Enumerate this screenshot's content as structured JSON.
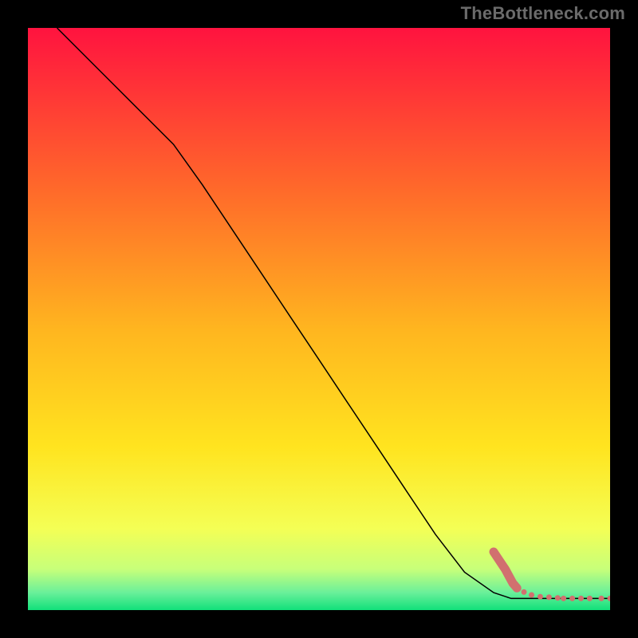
{
  "watermark": "TheBottleneck.com",
  "chart_data": {
    "type": "line",
    "title": "",
    "xlabel": "",
    "ylabel": "",
    "xlim": [
      0,
      100
    ],
    "ylim": [
      0,
      100
    ],
    "grid": false,
    "legend": false,
    "background_gradient": {
      "top_color": "#ff133f",
      "mid_upper_color": "#ff9a1f",
      "mid_color": "#ffe41f",
      "mid_lower_color": "#e8ff6c",
      "bottom_color": "#11e07a"
    },
    "series": [
      {
        "name": "black-curve",
        "type": "line",
        "color": "#000000",
        "width": 1.5,
        "x": [
          5,
          10,
          15,
          20,
          25,
          30,
          35,
          40,
          45,
          50,
          55,
          60,
          65,
          70,
          75,
          80,
          83,
          90,
          100
        ],
        "y": [
          100,
          95,
          90,
          85,
          80,
          73,
          65.5,
          58,
          50.5,
          43,
          35.5,
          28,
          20.5,
          13,
          6.5,
          3,
          2,
          2,
          2
        ]
      },
      {
        "name": "dotted-marker-trail",
        "type": "scatter",
        "color": "#d1706f",
        "marker_radius_main": 5,
        "marker_radius_small": 3.5,
        "x": [
          80,
          81,
          82,
          82.7,
          83.3,
          84,
          85.2,
          86.5,
          88,
          89.5,
          91,
          92,
          93.5,
          95,
          96.5,
          98.5,
          100
        ],
        "y": [
          10,
          8.5,
          7,
          5.7,
          4.6,
          3.8,
          3.1,
          2.6,
          2.3,
          2.2,
          2.1,
          2.0,
          2.0,
          2.0,
          2.0,
          2.0,
          2.0
        ]
      }
    ]
  }
}
